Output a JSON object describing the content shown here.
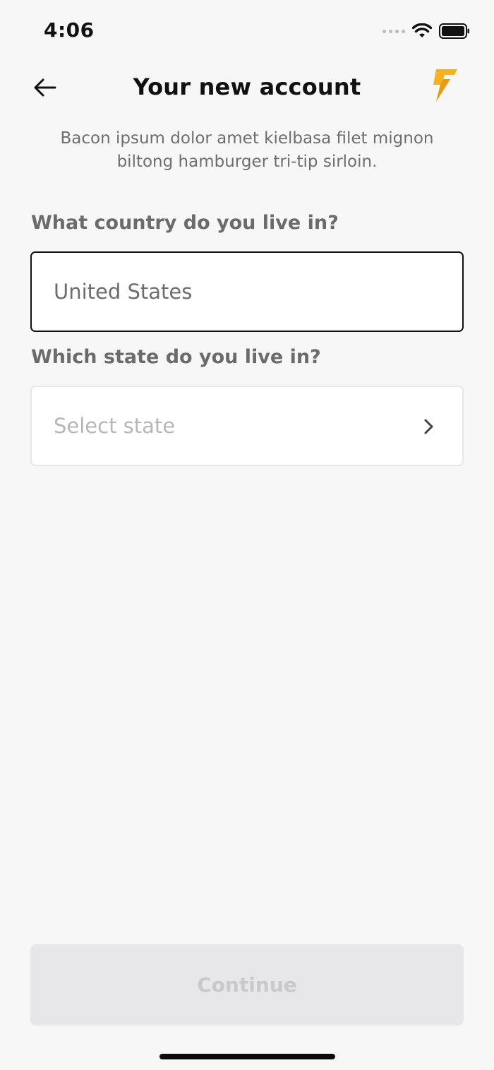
{
  "status_bar": {
    "time": "4:06",
    "icons": [
      "signal-dots-icon",
      "wifi-icon",
      "battery-icon"
    ]
  },
  "header": {
    "title": "Your new account",
    "back_icon": "arrow-left-icon",
    "logo_icon": "lightning-bolt-icon"
  },
  "intro": {
    "text": "Bacon ipsum dolor amet kielbasa filet mignon biltong hamburger tri-tip sirloin."
  },
  "form": {
    "country": {
      "label": "What country do you live in?",
      "value": "United States"
    },
    "state": {
      "label": "Which state do you live in?",
      "placeholder": "Select state",
      "icon": "chevron-right-icon"
    }
  },
  "footer": {
    "continue_label": "Continue",
    "continue_enabled": false
  },
  "colors": {
    "background": "#f7f7f7",
    "accent": "#f4b223",
    "accent_dark": "#e89a10",
    "field_border_active": "#111111",
    "field_border_idle": "#e7e7e7",
    "button_disabled_bg": "#e7e7e9",
    "button_disabled_text": "#c9c9cb"
  }
}
